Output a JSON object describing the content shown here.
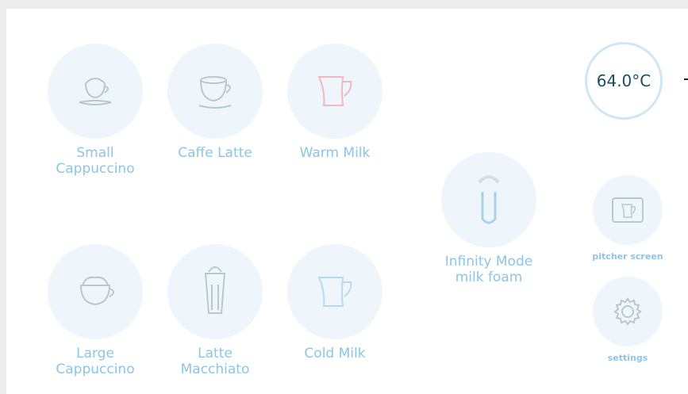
{
  "temperature": "64.0°C",
  "drinks": [
    {
      "label": "Small\nCappuccino",
      "icon": "cup-with-foam-icon"
    },
    {
      "label": "Caffe Latte",
      "icon": "latte-cup-icon"
    },
    {
      "label": "Warm Milk",
      "icon": "warm-milk-pitcher-icon"
    },
    {
      "label": "Large\nCappuccino",
      "icon": "large-cappuccino-icon"
    },
    {
      "label": "Latte\nMacchiato",
      "icon": "latte-macchiato-glass-icon"
    },
    {
      "label": "Cold Milk",
      "icon": "cold-milk-pitcher-icon"
    }
  ],
  "infinity": {
    "label": "Infinity Mode\nmilk foam",
    "icon": "infinity-milk-foam-icon"
  },
  "pitcher_screen": {
    "label": "pitcher screen",
    "icon": "pitcher-screen-icon"
  },
  "settings": {
    "label": "settings",
    "icon": "gear-icon"
  },
  "colors": {
    "accent": "#8cc5e6",
    "warm": "#f3b7bd",
    "cold": "#b8dcef",
    "circle": "#eef6fb"
  }
}
